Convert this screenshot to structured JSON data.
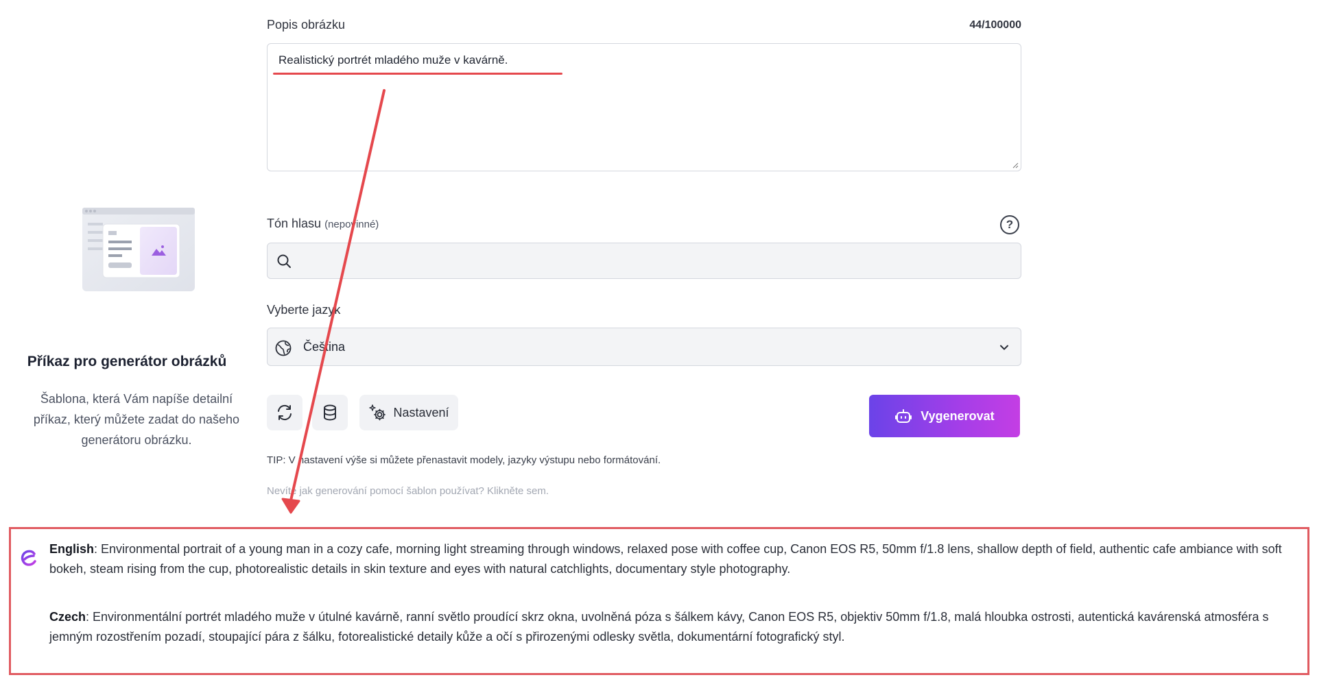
{
  "template_card": {
    "title": "Příkaz pro generátor obrázků",
    "description": "Šablona, která Vám napíše detailní příkaz, který můžete zadat do našeho generátoru obrázku."
  },
  "description_field": {
    "label": "Popis obrázku",
    "counter": "44/100000",
    "value": "Realistický portrét mladého muže v kavárně."
  },
  "tone_field": {
    "label": "Tón hlasu",
    "optional": "(nepovinné)",
    "value": "",
    "help_icon": "?"
  },
  "language_field": {
    "label": "Vyberte jazyk",
    "selected": "Čeština"
  },
  "toolbar": {
    "refresh_icon": "refresh-icon",
    "database_icon": "database-icon",
    "settings_label": "Nastavení",
    "generate_label": "Vygenerovat"
  },
  "tip_text": "TIP: V nastavení výše si můžete přenastavit modely, jazyky výstupu nebo formátování.",
  "help_link": "Nevíte jak generování pomocí šablon používat? Klikněte sem.",
  "output": {
    "english_label": "English",
    "english_text": ": Environmental portrait of a young man in a cozy cafe, morning light streaming through windows, relaxed pose with coffee cup, Canon EOS R5, 50mm f/1.8 lens, shallow depth of field, authentic cafe ambiance with soft bokeh, steam rising from the cup, photorealistic details in skin texture and eyes with natural catchlights, documentary style photography.",
    "czech_label": "Czech",
    "czech_text": ": Environmentální portrét mladého muže v útulné kavárně, ranní světlo proudící skrz okna, uvolněná póza s šálkem kávy, Canon EOS R5, objektiv 50mm f/1.8, malá hloubka ostrosti, autentická kavárenská atmosféra s jemným rozostřením pozadí, stoupající pára z šálku, fotorealistické detaily kůže a očí s přirozenými odlesky světla, dokumentární fotografický styl."
  },
  "colors": {
    "accent_start": "#6b43e8",
    "accent_end": "#c43ee4",
    "annotation_red": "#e05a60"
  }
}
